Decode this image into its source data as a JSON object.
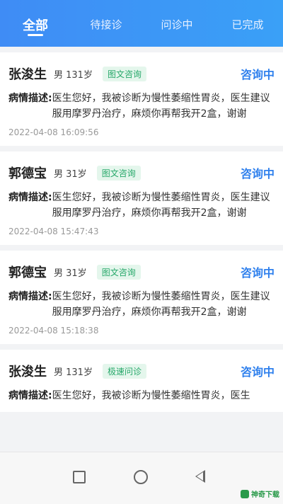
{
  "tabs": [
    {
      "label": "全部",
      "active": true
    },
    {
      "label": "待接诊",
      "active": false
    },
    {
      "label": "问诊中",
      "active": false
    },
    {
      "label": "已完成",
      "active": false
    }
  ],
  "cards": [
    {
      "name": "张浚生",
      "gender_age": "男 131岁",
      "tag": "图文咨询",
      "status": "咨询中",
      "desc_label": "病情描述:",
      "desc": "医生您好，我被诊断为慢性萎缩性胃炎，医生建议服用摩罗丹治疗，麻烦你再帮我开2盒，谢谢",
      "time": "2022-04-08 16:09:56"
    },
    {
      "name": "郭德宝",
      "gender_age": "男 31岁",
      "tag": "图文咨询",
      "status": "咨询中",
      "desc_label": "病情描述:",
      "desc": "医生您好，我被诊断为慢性萎缩性胃炎，医生建议服用摩罗丹治疗，麻烦你再帮我开2盒，谢谢",
      "time": "2022-04-08 15:47:43"
    },
    {
      "name": "郭德宝",
      "gender_age": "男 31岁",
      "tag": "图文咨询",
      "status": "咨询中",
      "desc_label": "病情描述:",
      "desc": "医生您好，我被诊断为慢性萎缩性胃炎，医生建议服用摩罗丹治疗，麻烦你再帮我开2盒，谢谢",
      "time": "2022-04-08 15:18:38"
    },
    {
      "name": "张浚生",
      "gender_age": "男 131岁",
      "tag": "极速问诊",
      "status": "咨询中",
      "desc_label": "病情描述:",
      "desc": "医生您好，我被诊断为慢性萎缩性胃炎，医生",
      "time": ""
    }
  ],
  "watermark": "神奇下载",
  "colors": {
    "accent": "#2f80ed",
    "tag_green": "#27a86a",
    "header_start": "#3f8cf5"
  }
}
